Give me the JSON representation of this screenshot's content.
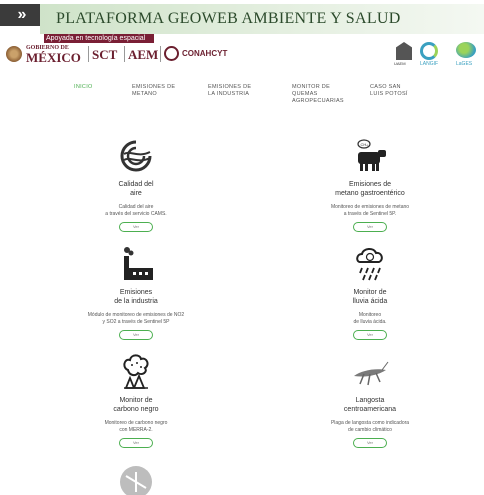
{
  "header": {
    "chevron": "»",
    "title": "PLATAFORMA GEOWEB AMBIENTE Y SALUD",
    "subtitle": "Apoyada en tecnología espacial"
  },
  "partners": {
    "gob_small": "GOBIERNO DE",
    "gob_big": "MÉXICO",
    "sct": "SCT",
    "aem": "AEM",
    "conahcyt": "CONAHCYT",
    "right_1": "UAEM",
    "right_2": "LANGIF",
    "right_3": "LaGES"
  },
  "nav": {
    "items": [
      {
        "label": "INICIO",
        "active": true
      },
      {
        "label": "EMISIONES DE METANO"
      },
      {
        "label": "EMISIONES DE LA INDUSTRIA"
      },
      {
        "label": "MONITOR DE QUEMAS AGROPECUARIAS"
      },
      {
        "label": "CASO SAN LUIS POTOSÍ"
      }
    ]
  },
  "cards": [
    {
      "name1": "Calidad del",
      "name2": "aire",
      "desc1": "Calidad del aire",
      "desc2": "a través del servicio CAMS.",
      "btn": "Ver",
      "icon": "air-quality-icon"
    },
    {
      "name1": "Emisiones de",
      "name2": "metano gastroentérico",
      "desc1": "Monitoreo de emisiones de metano",
      "desc2": "a través de Sentinel 5P.",
      "btn": "Ver",
      "icon": "cow-icon"
    },
    {
      "name1": "Emisiones",
      "name2": "de la industria",
      "desc1": "Módulo de monitoreo de emisiones de NO2",
      "desc2": "y SO2 a través de Sentinel 5P",
      "btn": "Ver",
      "icon": "factory-icon"
    },
    {
      "name1": "Monitor de",
      "name2": "lluvia ácida",
      "desc1": "Monitoreo",
      "desc2": "de lluvia ácida.",
      "btn": "Ver",
      "icon": "acid-rain-icon"
    },
    {
      "name1": "Monitor de",
      "name2": "carbono negro",
      "desc1": "Monitoreo de carbono negro",
      "desc2": "con MERRA-2.",
      "btn": "Ver",
      "icon": "black-carbon-icon"
    },
    {
      "name1": "Langosta",
      "name2": "centroamericana",
      "desc1": "Plaga de langosta como indicadora",
      "desc2": "de cambio climático",
      "btn": "Ver",
      "icon": "locust-icon"
    }
  ],
  "colors": {
    "accent": "#4caf50",
    "brand": "#6b1f2f",
    "banner": "#cfe3c9"
  }
}
